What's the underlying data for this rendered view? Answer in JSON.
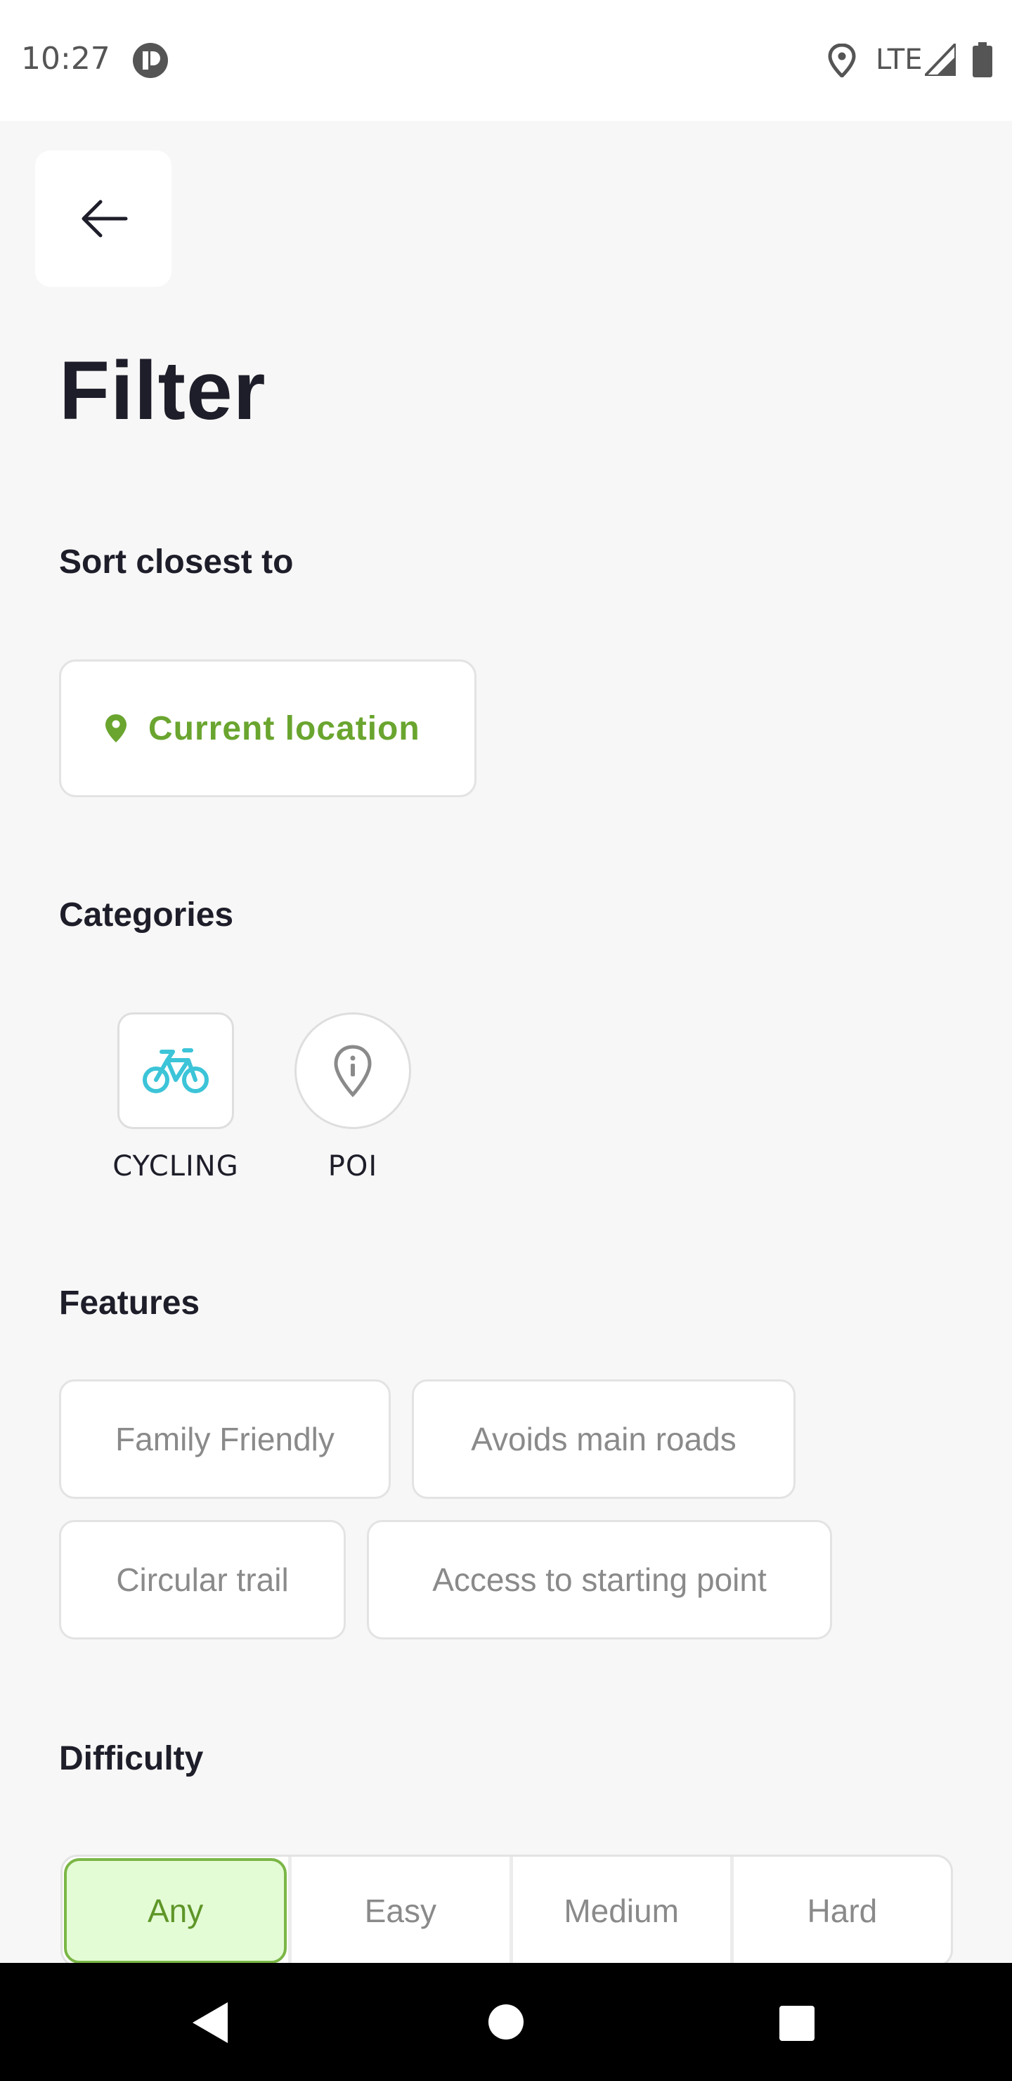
{
  "status_bar": {
    "time": "10:27",
    "network": "LTE",
    "icons": [
      "app-indicator-icon",
      "location-icon",
      "signal-icon",
      "battery-icon"
    ]
  },
  "header": {
    "back_icon": "arrow-left-icon",
    "title": "Filter"
  },
  "sort": {
    "section_title": "Sort closest to",
    "location_label": "Current location",
    "location_icon": "map-pin-icon"
  },
  "categories": {
    "section_title": "Categories",
    "items": [
      {
        "label": "CYCLING",
        "icon": "bicycle-icon",
        "selected": true
      },
      {
        "label": "POI",
        "icon": "poi-pin-icon",
        "selected": false
      }
    ]
  },
  "features": {
    "section_title": "Features",
    "chips": [
      "Family Friendly",
      "Avoids main roads",
      "Circular trail",
      "Access to starting point"
    ]
  },
  "difficulty": {
    "section_title": "Difficulty",
    "options": [
      "Any",
      "Easy",
      "Medium",
      "Hard"
    ],
    "selected": "Any"
  },
  "colors": {
    "accent_green": "#6aa52f",
    "cycling_blue": "#3cc4d8",
    "selected_bg": "#e4fcd6"
  }
}
